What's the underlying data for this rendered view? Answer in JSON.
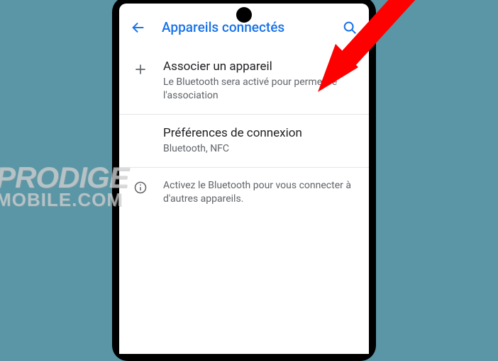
{
  "header": {
    "title": "Appareils connectés"
  },
  "rows": {
    "pair": {
      "title": "Associer un appareil",
      "subtitle": "Le Bluetooth sera activé pour permettre l'association"
    },
    "prefs": {
      "title": "Préférences de connexion",
      "subtitle": "Bluetooth, NFC"
    }
  },
  "info": {
    "text": "Activez le Bluetooth pour vous connecter à d'autres appareils."
  },
  "watermark": {
    "line1": "PRODIGE",
    "line2": "MOBILE.COM"
  }
}
